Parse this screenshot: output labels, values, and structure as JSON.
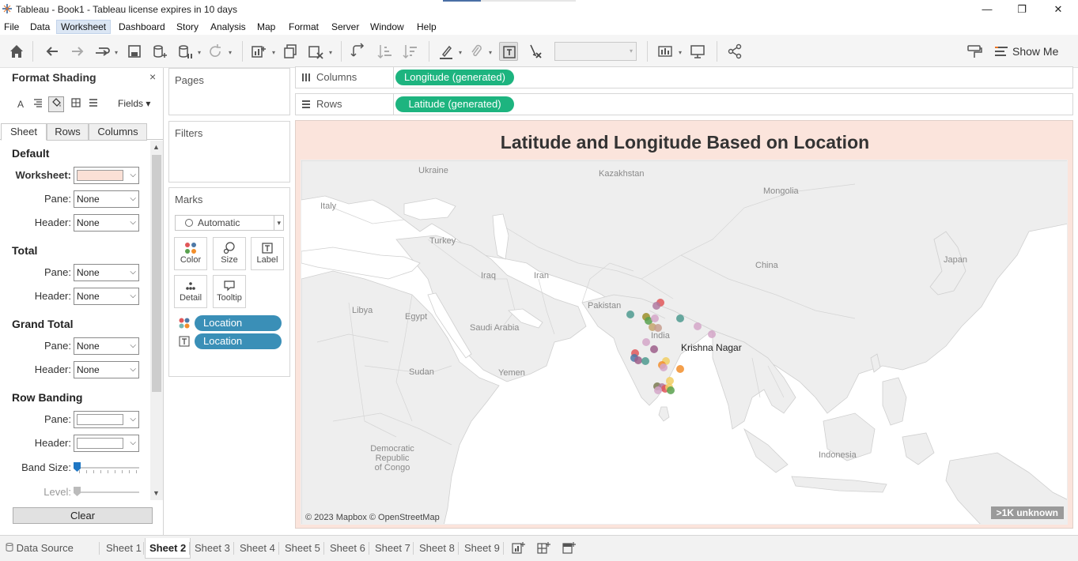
{
  "window": {
    "title": "Tableau - Book1 - Tableau license expires in 10 days",
    "minimize": "—",
    "restore": "❐",
    "close": "✕"
  },
  "menu": [
    "File",
    "Data",
    "Worksheet",
    "Dashboard",
    "Story",
    "Analysis",
    "Map",
    "Format",
    "Server",
    "Window",
    "Help"
  ],
  "menu_active": "Worksheet",
  "toolbar": {
    "show_me_label": "Show Me"
  },
  "format_pane": {
    "title": "Format Shading",
    "close": "×",
    "fields_label": "Fields ▾",
    "tabs": [
      "Sheet",
      "Rows",
      "Columns"
    ],
    "active_tab": "Sheet",
    "sections": {
      "default": {
        "heading": "Default",
        "worksheet_label": "Worksheet:",
        "worksheet_color": "#fbe0d6",
        "pane_label": "Pane:",
        "pane_value": "None",
        "header_label": "Header:",
        "header_value": "None"
      },
      "total": {
        "heading": "Total",
        "pane_label": "Pane:",
        "pane_value": "None",
        "header_label": "Header:",
        "header_value": "None"
      },
      "grand_total": {
        "heading": "Grand Total",
        "pane_label": "Pane:",
        "pane_value": "None",
        "header_label": "Header:",
        "header_value": "None"
      },
      "row_banding": {
        "heading": "Row Banding",
        "pane_label": "Pane:",
        "header_label": "Header:",
        "band_size_label": "Band Size:",
        "level_label": "Level:"
      }
    },
    "clear_label": "Clear"
  },
  "cards": {
    "pages": "Pages",
    "filters": "Filters",
    "marks": "Marks",
    "mark_type": "Automatic",
    "buttons": [
      "Color",
      "Size",
      "Label",
      "Detail",
      "Tooltip"
    ],
    "mark_pills": [
      "Location",
      "Location"
    ]
  },
  "shelves": {
    "columns_label": "Columns",
    "columns_pill": "Longitude (generated)",
    "rows_label": "Rows",
    "rows_pill": "Latitude (generated)"
  },
  "view": {
    "title": "Latitude and Longitude Based on Location",
    "background": "#fbe4dc",
    "map_labels": [
      "Ukraine",
      "Kazakhstan",
      "Mongolia",
      "Italy",
      "Turkey",
      "China",
      "Japan",
      "Iraq",
      "Iran",
      "Libya",
      "Egypt",
      "Pakistan",
      "Saudi Arabia",
      "India",
      "Sudan",
      "Yemen",
      "Indonesia",
      "Democratic",
      "Republic",
      "of Congo"
    ],
    "highlighted_city": "Krishna Nagar",
    "credit": "© 2023 Mapbox © OpenStreetMap",
    "unknown_badge": ">1K unknown"
  },
  "bottom_tabs": {
    "data_source": "Data Source",
    "sheets": [
      "Sheet 1",
      "Sheet 2",
      "Sheet 3",
      "Sheet 4",
      "Sheet 5",
      "Sheet 6",
      "Sheet 7",
      "Sheet 8",
      "Sheet 9"
    ],
    "active": "Sheet 2"
  },
  "colors": {
    "pill_green": "#1db47f",
    "pill_blue": "#3a8fb7",
    "worksheet_shading": "#fbe4dc"
  }
}
